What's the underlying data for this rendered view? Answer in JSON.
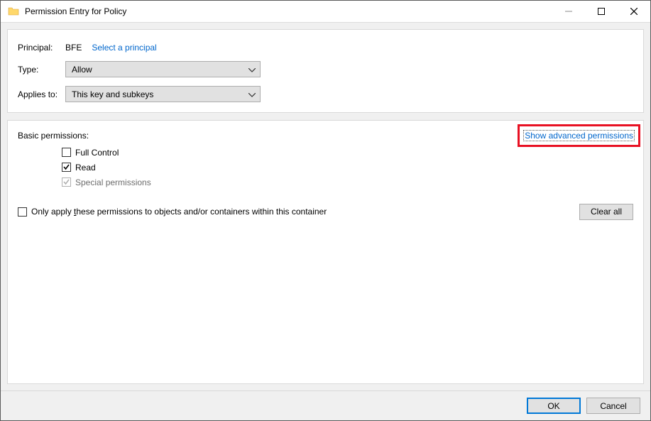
{
  "window": {
    "title": "Permission Entry for Policy"
  },
  "top": {
    "principal_label": "Principal:",
    "principal_value": "BFE",
    "select_principal": "Select a principal",
    "type_label": "Type:",
    "type_value": "Allow",
    "applies_label": "Applies to:",
    "applies_value": "This key and subkeys"
  },
  "perm": {
    "heading": "Basic permissions:",
    "advanced_link": "Show advanced permissions",
    "items": {
      "full_control": "Full Control",
      "read": "Read",
      "special": "Special permissions"
    },
    "only_apply_pre": "Only apply ",
    "only_apply_ul": "t",
    "only_apply_post": "hese permissions to objects and/or containers within this container",
    "clear_all": "Clear all"
  },
  "footer": {
    "ok": "OK",
    "cancel": "Cancel"
  }
}
